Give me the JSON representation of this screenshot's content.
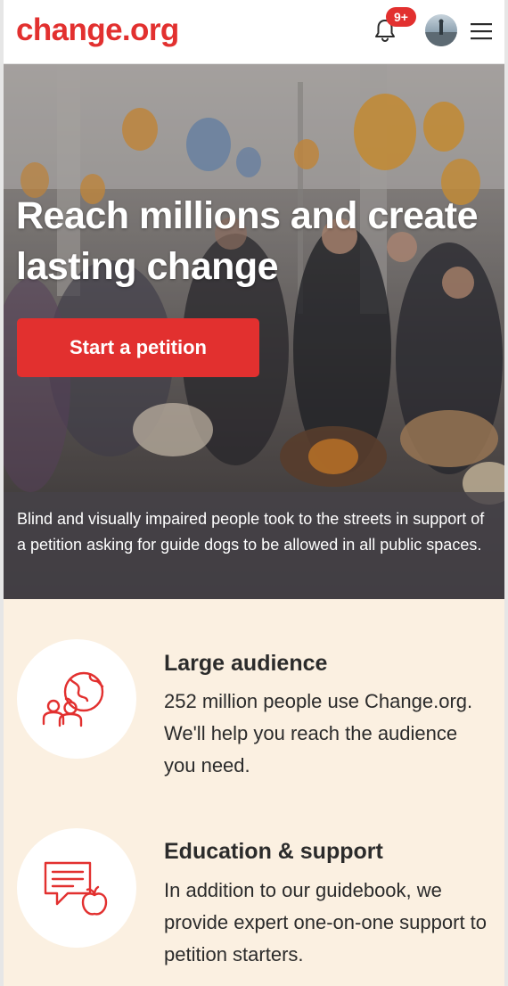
{
  "header": {
    "logo": "change.org",
    "notifications_badge": "9+",
    "bell_icon": "bell-icon",
    "avatar_icon": "user-avatar",
    "menu_icon": "hamburger-menu-icon"
  },
  "hero": {
    "title": "Reach millions and create lasting change",
    "cta_label": "Start a petition",
    "caption": "Blind and visually impaired people took to the streets in support of a petition asking for guide dogs to be allowed in all public spaces."
  },
  "features": [
    {
      "icon": "globe-people-icon",
      "title": "Large audience",
      "text": "252 million people use Change.org. We'll help you reach the audience you need."
    },
    {
      "icon": "chat-apple-icon",
      "title": "Education & support",
      "text": "In addition to our guidebook, we provide expert one-on-one support to petition starters."
    }
  ],
  "colors": {
    "brand": "#e2302f",
    "feature_background": "#fbf0e1",
    "caption_overlay": "#464248"
  }
}
